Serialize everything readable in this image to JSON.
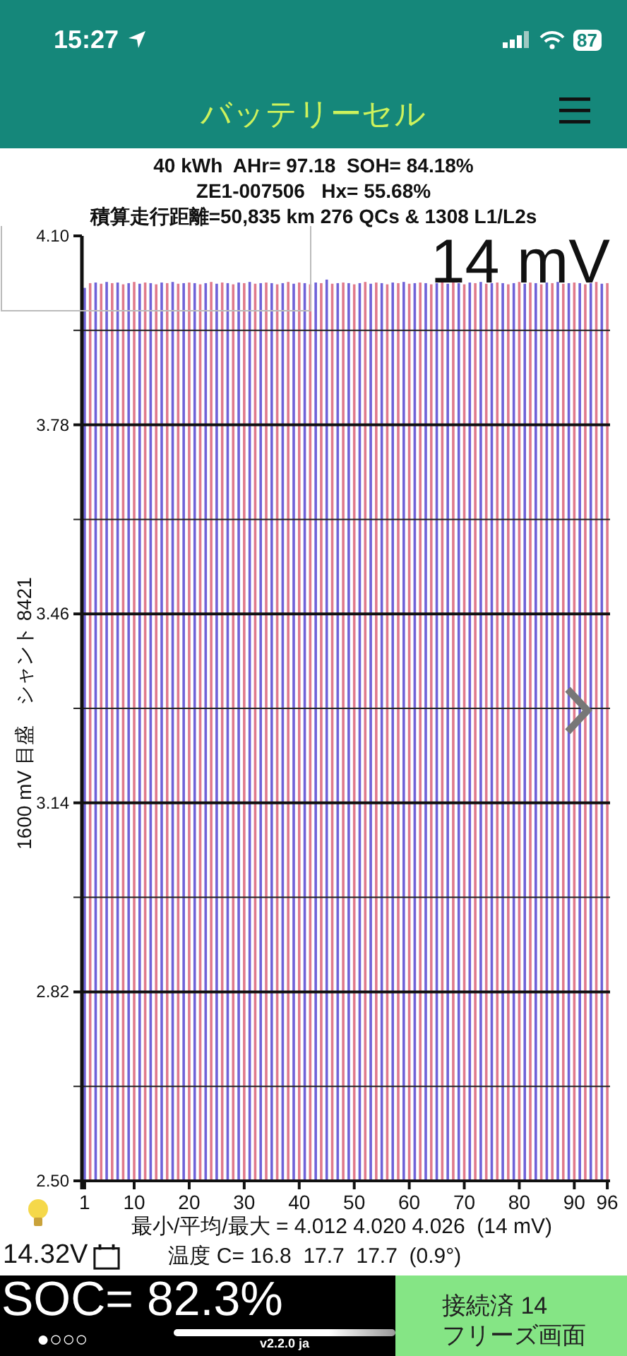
{
  "status_bar": {
    "time": "15:27",
    "battery": "87"
  },
  "header": {
    "title": "バッテリーセル"
  },
  "info_lines": [
    "40 kWh  AHr= 97.18  SOH= 84.18%",
    "ZE1-007506   Hx= 55.68%",
    "積算走行距離=50,835 km 276 QCs & 1308 L1/L2s"
  ],
  "chart": {
    "spread_label": "14 mV",
    "chart_data": {
      "type": "bar",
      "ylabel": "1600 mV 目盛　シャント 8421",
      "grid": true,
      "x": [
        1,
        2,
        3,
        4,
        5,
        6,
        7,
        8,
        9,
        10,
        11,
        12,
        13,
        14,
        15,
        16,
        17,
        18,
        19,
        20,
        21,
        22,
        23,
        24,
        25,
        26,
        27,
        28,
        29,
        30,
        31,
        32,
        33,
        34,
        35,
        36,
        37,
        38,
        39,
        40,
        41,
        42,
        43,
        44,
        45,
        46,
        47,
        48,
        49,
        50,
        51,
        52,
        53,
        54,
        55,
        56,
        57,
        58,
        59,
        60,
        61,
        62,
        63,
        64,
        65,
        66,
        67,
        68,
        69,
        70,
        71,
        72,
        73,
        74,
        75,
        76,
        77,
        78,
        79,
        80,
        81,
        82,
        83,
        84,
        85,
        86,
        87,
        88,
        89,
        90,
        91,
        92,
        93,
        94,
        95,
        96
      ],
      "xlim": [
        0.5,
        96.5
      ],
      "series": [
        {
          "color": "#6f62d8",
          "values": [
            4.012,
            null,
            4.021,
            null,
            4.022,
            null,
            4.021,
            null,
            4.02,
            null,
            4.019,
            null,
            4.02,
            null,
            4.021,
            null,
            4.022,
            null,
            4.02,
            null,
            4.02,
            null,
            4.02,
            null,
            4.019,
            null,
            4.02,
            null,
            4.021,
            null,
            4.022,
            null,
            4.02,
            null,
            4.02,
            null,
            4.02,
            null,
            4.019,
            null,
            4.02,
            null,
            4.021,
            null,
            4.026,
            null,
            4.02,
            null,
            4.02,
            null,
            4.02,
            null,
            4.019,
            null,
            4.02,
            null,
            4.021,
            null,
            4.022,
            null,
            4.02,
            null,
            4.02,
            null,
            4.02,
            null,
            4.019,
            null,
            4.02,
            null,
            4.021,
            null,
            4.022,
            null,
            4.02,
            null,
            4.02,
            null,
            4.02,
            null,
            4.019,
            null,
            4.02,
            null,
            4.021,
            null,
            4.022,
            null,
            4.02,
            null,
            4.02,
            null,
            4.02,
            null,
            4.019,
            null
          ]
        },
        {
          "color": "#e07a8c",
          "values": [
            null,
            4.02,
            null,
            4.019,
            null,
            4.02,
            null,
            4.018,
            null,
            4.022,
            null,
            4.021,
            null,
            4.018,
            null,
            4.02,
            null,
            4.019,
            null,
            4.021,
            null,
            4.018,
            null,
            4.022,
            null,
            4.021,
            null,
            4.018,
            null,
            4.02,
            null,
            4.019,
            null,
            4.021,
            null,
            4.018,
            null,
            4.022,
            null,
            4.021,
            null,
            4.018,
            null,
            4.02,
            null,
            4.019,
            null,
            4.021,
            null,
            4.018,
            null,
            4.022,
            null,
            4.021,
            null,
            4.018,
            null,
            4.02,
            null,
            4.019,
            null,
            4.021,
            null,
            4.018,
            null,
            4.022,
            null,
            4.021,
            null,
            4.018,
            null,
            4.02,
            null,
            4.019,
            null,
            4.021,
            null,
            4.018,
            null,
            4.022,
            null,
            4.021,
            null,
            4.018,
            null,
            4.02,
            null,
            4.019,
            null,
            4.021,
            null,
            4.018,
            null,
            4.022,
            null,
            4.02
          ]
        }
      ],
      "ylim": [
        2.5,
        4.1
      ],
      "yticks": [
        {
          "value": 2.5,
          "label": "2.50"
        },
        {
          "value": 2.82,
          "label": "2.82"
        },
        {
          "value": 3.14,
          "label": "3.14"
        },
        {
          "value": 3.46,
          "label": "3.46"
        },
        {
          "value": 3.78,
          "label": "3.78"
        },
        {
          "value": 4.1,
          "label": "4.10"
        }
      ],
      "xticks": [
        1,
        10,
        20,
        30,
        40,
        50,
        60,
        70,
        80,
        90,
        96
      ]
    }
  },
  "stats": {
    "minmax": "最小/平均/最大 = 4.012 4.020 4.026  (14 mV)",
    "aux_voltage": "14.32V",
    "temperature": "温度 C= 16.8  17.7  17.7  (0.9°)"
  },
  "footer": {
    "soc": "SOC= 82.3%",
    "pages": "●○○○",
    "version": "v2.2.0 ja",
    "connection": "接続済 14",
    "freeze": "フリーズ画面"
  }
}
